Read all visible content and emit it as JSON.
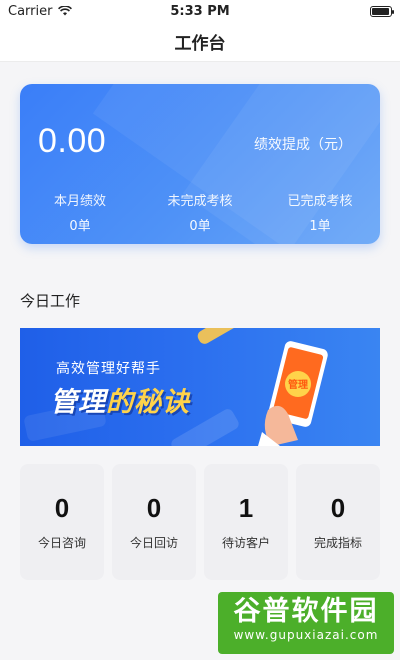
{
  "status_bar": {
    "carrier": "Carrier",
    "time": "5:33 PM",
    "battery_level": 0.95
  },
  "nav": {
    "title": "工作台"
  },
  "hero": {
    "amount": "0.00",
    "amount_label": "绩效提成（元）",
    "stats": [
      {
        "label": "本月绩效",
        "value": "0单"
      },
      {
        "label": "未完成考核",
        "value": "0单"
      },
      {
        "label": "已完成考核",
        "value": "1单"
      }
    ]
  },
  "section": {
    "title": "今日工作"
  },
  "banner": {
    "subtitle": "高效管理好帮手",
    "headline_part1": "管理",
    "headline_part2": "的秘诀",
    "phone_badge": "管理"
  },
  "grid": [
    {
      "num": "0",
      "label": "今日咨询"
    },
    {
      "num": "0",
      "label": "今日回访"
    },
    {
      "num": "1",
      "label": "待访客户"
    },
    {
      "num": "0",
      "label": "完成指标"
    }
  ],
  "watermark": {
    "title": "谷普软件园",
    "url": "www.gupuxiazai.com"
  },
  "colors": {
    "hero_blue": "#3a7ef8",
    "banner_blue": "#1f5fe8",
    "accent_yellow": "#ffd34a",
    "watermark_green": "#4caf2a"
  }
}
